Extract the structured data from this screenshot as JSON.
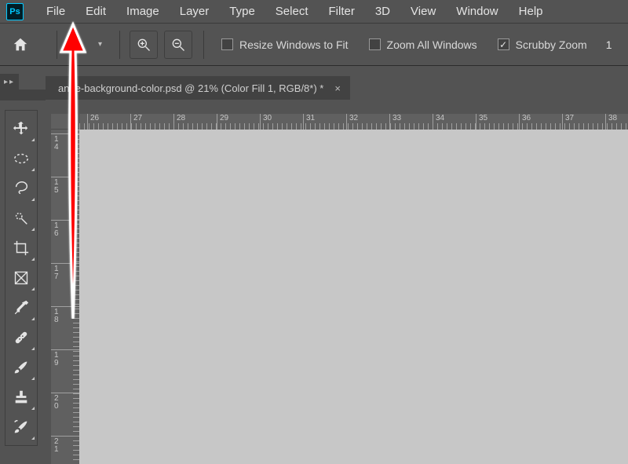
{
  "app": {
    "logo_text": "Ps"
  },
  "menubar": {
    "items": [
      {
        "label": "File"
      },
      {
        "label": "Edit"
      },
      {
        "label": "Image"
      },
      {
        "label": "Layer"
      },
      {
        "label": "Type"
      },
      {
        "label": "Select"
      },
      {
        "label": "Filter"
      },
      {
        "label": "3D"
      },
      {
        "label": "View"
      },
      {
        "label": "Window"
      },
      {
        "label": "Help"
      }
    ]
  },
  "optionsbar": {
    "resize_windows": {
      "label": "Resize Windows to Fit",
      "checked": false
    },
    "zoom_all": {
      "label": "Zoom All Windows",
      "checked": false
    },
    "scrubby_zoom": {
      "label": "Scrubby Zoom",
      "checked": true
    },
    "trailing_value": "1"
  },
  "document": {
    "tab_label": "ange-background-color.psd @ 21% (Color Fill 1, RGB/8*) *"
  },
  "tools": [
    {
      "name": "move-tool"
    },
    {
      "name": "marquee-tool"
    },
    {
      "name": "lasso-tool"
    },
    {
      "name": "quick-select-tool"
    },
    {
      "name": "crop-tool"
    },
    {
      "name": "frame-tool"
    },
    {
      "name": "eyedropper-tool"
    },
    {
      "name": "healing-brush-tool"
    },
    {
      "name": "brush-tool"
    },
    {
      "name": "clone-stamp-tool"
    },
    {
      "name": "history-brush-tool"
    }
  ],
  "ruler": {
    "horizontal_ticks": [
      "26",
      "27",
      "28",
      "29",
      "30",
      "31",
      "32",
      "33",
      "34",
      "35",
      "36",
      "37",
      "38"
    ],
    "vertical_ticks": [
      "14",
      "15",
      "16",
      "17",
      "18",
      "19",
      "20",
      "21"
    ]
  }
}
